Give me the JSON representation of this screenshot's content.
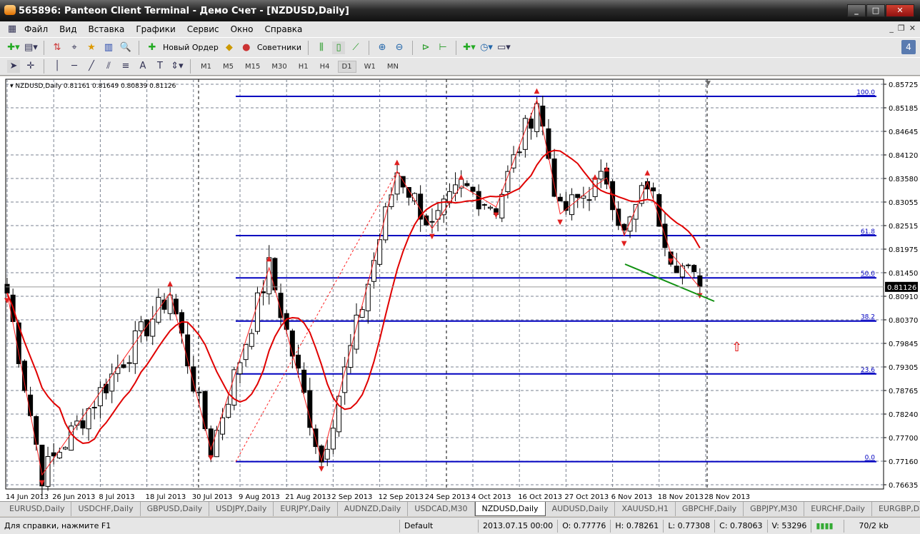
{
  "window": {
    "title": "565896: Panteon Client Terminal - Демо Счет - [NZDUSD,Daily]"
  },
  "menu": [
    "Файл",
    "Вид",
    "Вставка",
    "Графики",
    "Сервис",
    "Окно",
    "Справка"
  ],
  "toolbar": {
    "new_order": "Новый Ордер",
    "experts": "Советники",
    "notifications": "4"
  },
  "timeframes": [
    "M1",
    "M5",
    "M15",
    "M30",
    "H1",
    "H4",
    "D1",
    "W1",
    "MN"
  ],
  "active_timeframe": "D1",
  "chart": {
    "header": "NZDUSD,Daily  0.81161 0.81649 0.80839 0.81126",
    "price_ticks": [
      "0.85725",
      "0.85185",
      "0.84645",
      "0.84120",
      "0.83580",
      "0.83055",
      "0.82515",
      "0.81975",
      "0.81450",
      "0.80910",
      "0.80370",
      "0.79845",
      "0.79305",
      "0.78765",
      "0.78240",
      "0.77700",
      "0.77160",
      "0.76635"
    ],
    "current_price": "0.81126",
    "date_labels": [
      "14 Jun 2013",
      "26 Jun 2013",
      "8 Jul 2013",
      "18 Jul 2013",
      "30 Jul 2013",
      "9 Aug 2013",
      "21 Aug 2013",
      "2 Sep 2013",
      "12 Sep 2013",
      "24 Sep 2013",
      "4 Oct 2013",
      "16 Oct 2013",
      "27 Oct 2013",
      "6 Nov 2013",
      "18 Nov 2013",
      "28 Nov 2013"
    ],
    "fib_levels": [
      {
        "label": "100.0",
        "price": 0.8545
      },
      {
        "label": "61.8",
        "price": 0.8229
      },
      {
        "label": "50.0",
        "price": 0.8133
      },
      {
        "label": "38.2",
        "price": 0.8035
      },
      {
        "label": "23.6",
        "price": 0.7915
      },
      {
        "label": "0.0",
        "price": 0.7716
      }
    ],
    "swing_points": [
      [
        0,
        0.8099
      ],
      [
        6,
        0.7686
      ],
      [
        28,
        0.8099
      ],
      [
        35,
        0.7743
      ],
      [
        45,
        0.8156
      ],
      [
        54,
        0.7718
      ],
      [
        67,
        0.8375
      ],
      [
        73,
        0.8245
      ],
      [
        78,
        0.8342
      ],
      [
        84,
        0.8294
      ],
      [
        91,
        0.8537
      ],
      [
        95,
        0.8278
      ],
      [
        101,
        0.8342
      ],
      [
        103,
        0.836
      ],
      [
        106,
        0.8229
      ],
      [
        110,
        0.8351
      ],
      [
        114,
        0.8189
      ],
      [
        119,
        0.8111
      ]
    ],
    "colors": {
      "bull": "#ffffff",
      "bear": "#000000",
      "ma": "#e00000",
      "fib": "#0000c0",
      "trend": "#109010",
      "zigzag": "#ff2020"
    }
  },
  "tabs": [
    "EURUSD,Daily",
    "USDCHF,Daily",
    "GBPUSD,Daily",
    "USDJPY,Daily",
    "EURJPY,Daily",
    "AUDNZD,Daily",
    "USDCAD,M30",
    "NZDUSD,Daily",
    "AUDUSD,Daily",
    "XAUUSD,H1",
    "GBPCHF,Daily",
    "GBPJPY,M30",
    "EURCHF,Daily",
    "EURGBP,Daily"
  ],
  "active_tab": "NZDUSD,Daily",
  "status": {
    "help": "Для справки, нажмите F1",
    "profile": "Default",
    "datetime": "2013.07.15 00:00",
    "open": "O: 0.77776",
    "high": "H: 0.78261",
    "low": "L: 0.77308",
    "close": "C: 0.78063",
    "volume": "V: 53296",
    "traffic": "70/2 kb"
  }
}
